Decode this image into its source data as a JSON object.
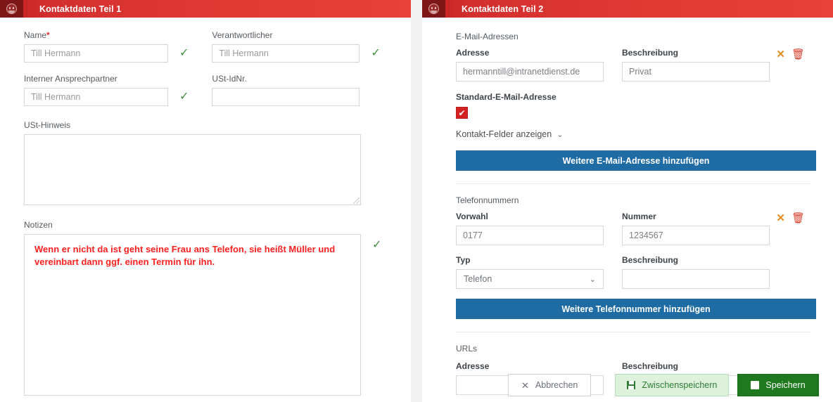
{
  "left_panel": {
    "header": {
      "title": "Kontaktdaten Teil 1",
      "icon": "contact-face-icon"
    },
    "fields": {
      "name_label": "Name",
      "name_required_marker": "*",
      "name_value": "Till Hermann",
      "verantwortlicher_label": "Verantwortlicher",
      "verantwortlicher_value": "Till Hermann",
      "interner_label": "Interner Ansprechpartner",
      "interner_value": "Till Hermann",
      "ustid_label": "USt-IdNr.",
      "ustid_value": "",
      "usthinweis_label": "USt-Hinweis",
      "usthinweis_value": "",
      "notizen_label": "Notizen",
      "notizen_value": "Wenn er nicht da ist geht seine Frau ans Telefon, sie heißt Müller und vereinbart dann ggf. einen Termin für ihn."
    },
    "valid_glyph": "✓"
  },
  "right_panel": {
    "header": {
      "title": "Kontaktdaten Teil 2",
      "icon": "contact-face-icon"
    },
    "email_section": {
      "group_label": "E-Mail-Adressen",
      "adresse_label": "Adresse",
      "adresse_value": "hermanntill@intranetdienst.de",
      "beschreibung_label": "Beschreibung",
      "beschreibung_value": "Privat",
      "standard_label": "Standard-E-Mail-Adresse",
      "standard_checked": true,
      "check_glyph": "✔",
      "toggle_label": "Kontakt-Felder anzeigen",
      "chevron_glyph": "⌄",
      "add_button": "Weitere E-Mail-Adresse hinzufügen",
      "remove_x_glyph": "✕",
      "remove_trash_glyph": "🗑"
    },
    "phone_section": {
      "group_label": "Telefonnummern",
      "vorwahl_label": "Vorwahl",
      "vorwahl_value": "0177",
      "nummer_label": "Nummer",
      "nummer_value": "1234567",
      "typ_label": "Typ",
      "typ_value": "Telefon",
      "beschreibung_label": "Beschreibung",
      "beschreibung_value": "",
      "add_button": "Weitere Telefonnummer hinzufügen",
      "remove_x_glyph": "✕",
      "remove_trash_glyph": "🗑"
    },
    "url_section": {
      "group_label": "URLs",
      "adresse_label": "Adresse",
      "beschreibung_label": "Beschreibung"
    }
  },
  "action_bar": {
    "cancel_label": "Abbrechen",
    "cancel_icon": "close-x-icon",
    "draft_label": "Zwischenspeichern",
    "draft_icon": "save-disk-icon",
    "save_label": "Speichern",
    "save_icon": "save-disk-icon"
  },
  "colors": {
    "header_red": "#d32f2f",
    "header_icon_red": "#7d1616",
    "accent_blue": "#1f6ba4",
    "save_green": "#1f7a1f",
    "draft_green_bg": "#ddf1dd",
    "valid_green": "#3f8f3f",
    "note_red": "#ff1f1f",
    "checkbox_red": "#d42222",
    "trash_red": "#e03b28",
    "x_orange": "#e08c1e"
  }
}
